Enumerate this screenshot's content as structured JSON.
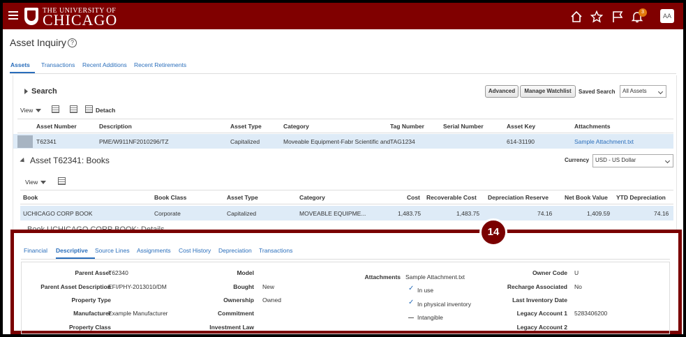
{
  "header": {
    "logo_small": "THE UNIVERSITY OF",
    "logo_big": "CHICAGO",
    "notification_count": "3",
    "avatar_initials": "AA",
    "brand_color": "#800000"
  },
  "page": {
    "title": "Asset Inquiry",
    "tabs": [
      {
        "label": "Assets",
        "active": true
      },
      {
        "label": "Transactions"
      },
      {
        "label": "Recent Additions"
      },
      {
        "label": "Recent Retirements"
      }
    ]
  },
  "search": {
    "title": "Search",
    "advanced_label": "Advanced",
    "watchlist_label": "Manage Watchlist",
    "saved_search_label": "Saved Search",
    "saved_search_value": "All Assets"
  },
  "assets_table": {
    "view_label": "View",
    "detach_label": "Detach",
    "columns": [
      "Asset Number",
      "Description",
      "Asset Type",
      "Category",
      "Tag Number",
      "Serial Number",
      "Asset Key",
      "Attachments"
    ],
    "row": {
      "asset_number": "T62341",
      "description": "PME/W911NF2010296/TZ",
      "asset_type": "Capitalized",
      "category": "Moveable Equipment-Fabr Scientific and",
      "tag_number": "TAG1234",
      "serial_number": "",
      "asset_key": "614-31190",
      "attachments": "Sample Attachment.txt"
    }
  },
  "books": {
    "title": "Asset T62341: Books",
    "currency_label": "Currency",
    "currency_value": "USD - US Dollar",
    "view_label": "View",
    "columns": [
      "Book",
      "Book Class",
      "Asset Type",
      "Category",
      "Cost",
      "Recoverable Cost",
      "Depreciation Reserve",
      "Net Book Value",
      "YTD Depreciation"
    ],
    "row": {
      "book": "UCHICAGO CORP BOOK",
      "book_class": "Corporate",
      "asset_type": "Capitalized",
      "category": "MOVEABLE EQUIPME...",
      "cost": "1,483.75",
      "recoverable_cost": "1,483.75",
      "depreciation_reserve": "74.16",
      "net_book_value": "1,409.59",
      "ytd_depreciation": "74.16"
    }
  },
  "details": {
    "title": "Book UCHICAGO CORP BOOK: Details",
    "callout": "14",
    "tabs": [
      {
        "label": "Financial"
      },
      {
        "label": "Descriptive",
        "active": true
      },
      {
        "label": "Source Lines"
      },
      {
        "label": "Assignments"
      },
      {
        "label": "Cost History"
      },
      {
        "label": "Depreciation"
      },
      {
        "label": "Transactions"
      }
    ],
    "col1": [
      {
        "label": "Parent Asset",
        "value": "T62340"
      },
      {
        "label": "Parent Asset Description",
        "value": "EFI/PHY-2013010/DM"
      },
      {
        "label": "Property Type",
        "value": ""
      },
      {
        "label": "Manufacturer",
        "value": "Example Manufacturer"
      },
      {
        "label": "Property Class",
        "value": ""
      }
    ],
    "col2": [
      {
        "label": "Model",
        "value": ""
      },
      {
        "label": "Bought",
        "value": "New"
      },
      {
        "label": "Ownership",
        "value": "Owned"
      },
      {
        "label": "Commitment",
        "value": ""
      },
      {
        "label": "Investment Law",
        "value": ""
      }
    ],
    "col3": {
      "attachments_label": "Attachments",
      "attachments_value": "Sample Attachment.txt",
      "in_use": "In use",
      "in_physical_inventory": "In physical inventory",
      "intangible": "Intangible"
    },
    "col4": [
      {
        "label": "Owner Code",
        "value": "U"
      },
      {
        "label": "Recharge Associated",
        "value": "No"
      },
      {
        "label": "Last Inventory Date",
        "value": ""
      },
      {
        "label": "Legacy Account 1",
        "value": "5283406200"
      },
      {
        "label": "Legacy Account 2",
        "value": ""
      }
    ]
  }
}
